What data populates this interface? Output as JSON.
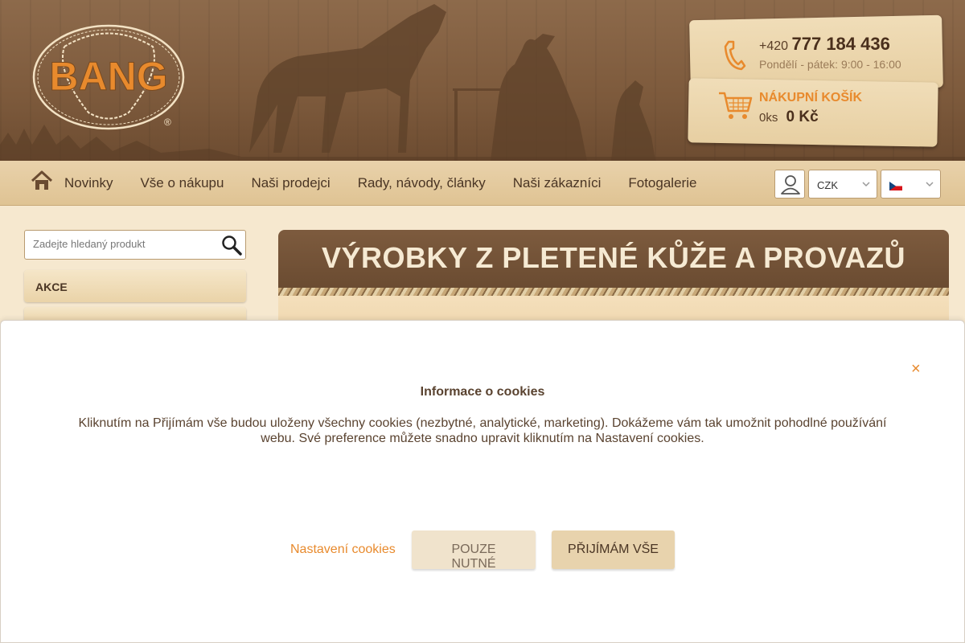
{
  "brand": {
    "logo_text": "BANG",
    "registered_mark": "®"
  },
  "header": {
    "phone_prefix": "+420",
    "phone_number": "777 184 436",
    "hours": "Pondělí - pátek: 9:00 - 16:00",
    "cart_title": "NÁKUPNÍ KOŠÍK",
    "cart_count": "0ks",
    "cart_total": "0 Kč"
  },
  "nav": {
    "items": [
      "Novinky",
      "Vše o nákupu",
      "Naši prodejci",
      "Rady, návody, články",
      "Naši zákazníci",
      "Fotogalerie"
    ],
    "currency": "CZK"
  },
  "sidebar": {
    "search_placeholder": "Zadejte hledaný produkt",
    "categories": [
      "AKCE"
    ]
  },
  "main": {
    "title": "VÝROBKY Z PLETENÉ KŮŽE A PROVAZŮ"
  },
  "cookie": {
    "close": "×",
    "title": "Informace o cookies",
    "text": "Kliknutím na Přijímám vše budou uloženy všechny cookies (nezbytné, analytické, marketing). Dokážeme vám tak umožnit pohodlné používání webu. Své preference můžete snadno upravit kliknutím na Nastavení cookies.",
    "settings_link": "Nastavení cookies",
    "necessary_button": "POUZE NUTNÉ",
    "accept_button": "PŘIJÍMÁM VŠE"
  },
  "colors": {
    "accent": "#e88a2d",
    "wood_dark": "#6a4b31",
    "wood_light": "#f0ddb8"
  }
}
